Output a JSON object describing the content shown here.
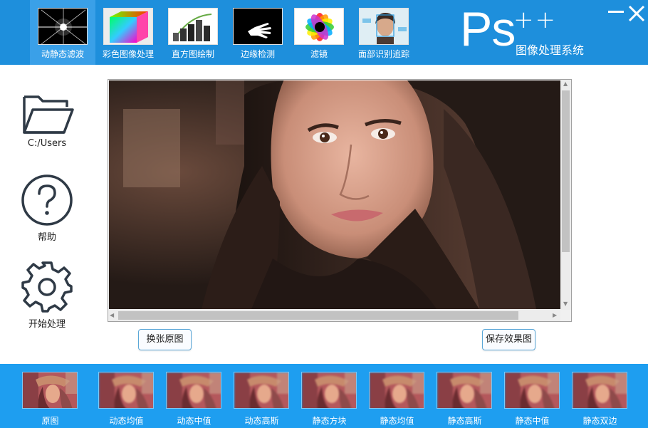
{
  "toolbar": {
    "tools": [
      {
        "label": "动静态滤波",
        "icon": "starburst-filter-icon",
        "active": true
      },
      {
        "label": "彩色图像处理",
        "icon": "color-cube-icon",
        "active": false
      },
      {
        "label": "直方图绘制",
        "icon": "histogram-bars-icon",
        "active": false
      },
      {
        "label": "边缘检测",
        "icon": "hand-edge-icon",
        "active": false
      },
      {
        "label": "滤镜",
        "icon": "color-wheel-icon",
        "active": false
      },
      {
        "label": "面部识别追踪",
        "icon": "face-tracking-icon",
        "active": false
      }
    ]
  },
  "brand": {
    "logo_main": "Ps",
    "logo_plus": "++",
    "subtitle": "图像处理系统"
  },
  "window": {
    "minimize_icon": "minimize-icon",
    "close_icon": "close-icon"
  },
  "sidebar": {
    "open": {
      "label": "C:/Users",
      "icon": "folder-icon"
    },
    "help": {
      "label": "帮助",
      "icon": "question-circle-icon"
    },
    "process": {
      "label": "开始处理",
      "icon": "gear-icon"
    }
  },
  "viewer": {
    "image_icon": "portrait-photo"
  },
  "actions": {
    "replace_label": "换张原图",
    "save_label": "保存效果图"
  },
  "filters": [
    "原图",
    "动态均值",
    "动态中值",
    "动态高斯",
    "静态方块",
    "静态均值",
    "静态高斯",
    "静态中值",
    "静态双边"
  ],
  "colors": {
    "topbar": "#1e8fdc",
    "bottombar": "#1e9ef0",
    "active_tool": "#3aa0e8",
    "button_border": "#5aa7d8"
  }
}
